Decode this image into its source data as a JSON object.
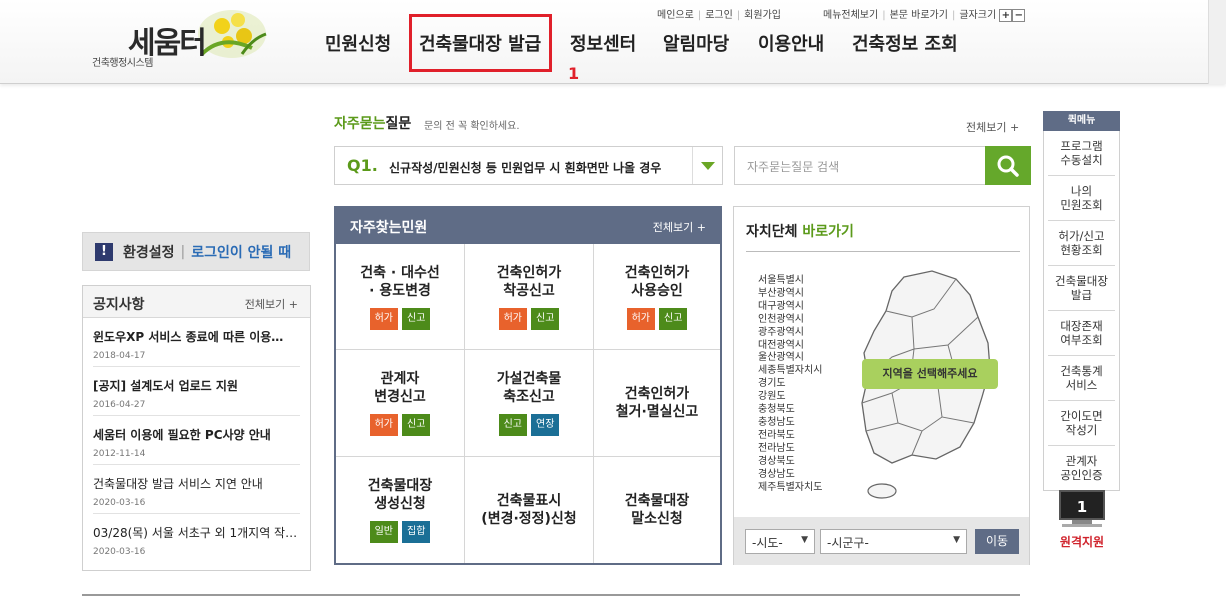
{
  "header": {
    "logo_title": "세움터",
    "logo_sub": "건축행정시스템",
    "nav": [
      "민원신청",
      "건축물대장 발급",
      "정보센터",
      "알림마당",
      "이용안내",
      "건축정보 조회"
    ],
    "annotation_mark": "1",
    "util_links": [
      "메인으로",
      "로그인",
      "회원가입"
    ],
    "util_links2": [
      "메뉴전체보기",
      "본문 바로가기",
      "글자크기"
    ],
    "font_plus": "+",
    "font_minus": "−"
  },
  "env": {
    "icon": "!",
    "label": "환경설정",
    "link": "로그인이 안될 때"
  },
  "notice": {
    "title": "공지사항",
    "more": "전체보기 +",
    "items": [
      {
        "text": "윈도우XP 서비스 종료에 따른 이용…",
        "date": "2018-04-17",
        "bold": true
      },
      {
        "text": "[공지] 설계도서 업로드 지원",
        "date": "2016-04-27",
        "bold": true
      },
      {
        "text": "세움터 이용에 필요한 PC사양 안내",
        "date": "2012-11-14",
        "bold": true
      },
      {
        "text": "건축물대장 발급 서비스 지연 안내",
        "date": "2020-03-16",
        "bold": false
      },
      {
        "text": "03/28(목) 서울 서초구 외 1개지역 작업…",
        "date": "2020-03-16",
        "bold": false
      }
    ]
  },
  "faq": {
    "title_accent": "자주묻는",
    "title_rest": "질문",
    "subtitle": "문의 전 꼭 확인하세요.",
    "more": "전체보기 +",
    "q_label": "Q1.",
    "q_text": "신규작성/민원신청 등 민원업무 시 흰화면만 나올 경우",
    "search_placeholder": "자주묻는질문 검색"
  },
  "popular": {
    "title": "자주찾는민원",
    "more": "전체보기 +",
    "cells": [
      {
        "title": "건축 · 대수선\n· 용도변경",
        "badges": [
          {
            "label": "허가",
            "color": "orange"
          },
          {
            "label": "신고",
            "color": "green"
          }
        ]
      },
      {
        "title": "건축인허가\n착공신고",
        "badges": [
          {
            "label": "허가",
            "color": "orange"
          },
          {
            "label": "신고",
            "color": "green"
          }
        ]
      },
      {
        "title": "건축인허가\n사용승인",
        "badges": [
          {
            "label": "허가",
            "color": "orange"
          },
          {
            "label": "신고",
            "color": "green"
          }
        ]
      },
      {
        "title": "관계자\n변경신고",
        "badges": [
          {
            "label": "허가",
            "color": "orange"
          },
          {
            "label": "신고",
            "color": "green"
          }
        ]
      },
      {
        "title": "가설건축물\n축조신고",
        "badges": [
          {
            "label": "신고",
            "color": "green"
          },
          {
            "label": "연장",
            "color": "blue"
          }
        ]
      },
      {
        "title": "건축인허가\n철거·멸실신고",
        "badges": []
      },
      {
        "title": "건축물대장\n생성신청",
        "badges": [
          {
            "label": "일반",
            "color": "green"
          },
          {
            "label": "집합",
            "color": "blue"
          }
        ]
      },
      {
        "title": "건축물표시\n(변경·정정)신청",
        "badges": []
      },
      {
        "title": "건축물대장\n말소신청",
        "badges": []
      }
    ]
  },
  "region": {
    "title_main": "자치단체",
    "title_accent": "바로가기",
    "list": [
      "서울특별시",
      "부산광역시",
      "대구광역시",
      "인천광역시",
      "광주광역시",
      "대전광역시",
      "울산광역시",
      "세종특별자치시",
      "경기도",
      "강원도",
      "충청북도",
      "충청남도",
      "전라북도",
      "전라남도",
      "경상북도",
      "경상남도",
      "제주특별자치도"
    ],
    "map_badge": "지역을 선택해주세요",
    "sido": "-시도-",
    "sigungu": "-시군구-",
    "go": "이동"
  },
  "quick": {
    "title": "퀵메뉴",
    "items": [
      "프로그램\n수동설치",
      "나의\n민원조회",
      "허가/신고\n현황조회",
      "건축물대장\n발급",
      "대장존재\n여부조회",
      "건축통계\n서비스",
      "간이도면\n작성기",
      "관계자\n공인인증"
    ],
    "remote_num": "1",
    "remote_label": "원격지원"
  },
  "colors": {
    "accent_green": "#65a82b",
    "panel_navy": "#5f6c86",
    "highlight_red": "#e0202a"
  }
}
